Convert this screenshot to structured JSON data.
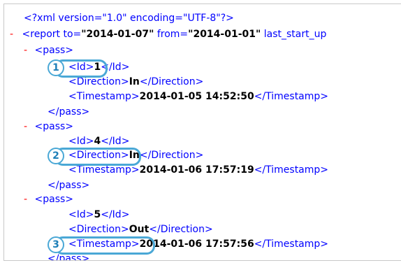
{
  "declaration": "<?xml version=\"1.0\" encoding=\"UTF-8\"?>",
  "collapse_marker": "-",
  "report": {
    "open_prefix": "<report to=",
    "to_value": "\"2014-01-07\"",
    "from_label": " from=",
    "from_value": "\"2014-01-01\"",
    "last_label": " last_start_up"
  },
  "passes": [
    {
      "id": "1",
      "direction": "In",
      "timestamp": "2014-01-05 14:52:50"
    },
    {
      "id": "4",
      "direction": "In",
      "timestamp": "2014-01-06 17:57:19"
    },
    {
      "id": "5",
      "direction": "Out",
      "timestamp": "2014-01-06 17:57:56"
    }
  ],
  "tags": {
    "pass_open": "<pass>",
    "pass_close": "</pass>",
    "id_open": "<Id>",
    "id_close": "</Id>",
    "direction_open": "<Direction>",
    "direction_close": "</Direction>",
    "timestamp_open": "<Timestamp>",
    "timestamp_close": "</Timestamp>"
  },
  "callouts": [
    "1",
    "2",
    "3"
  ],
  "colors": {
    "tag": "#0000ff",
    "attribute_name": "#990000",
    "value": "#000000",
    "collapse": "#ff0000",
    "callout": "#4aa8d6"
  }
}
